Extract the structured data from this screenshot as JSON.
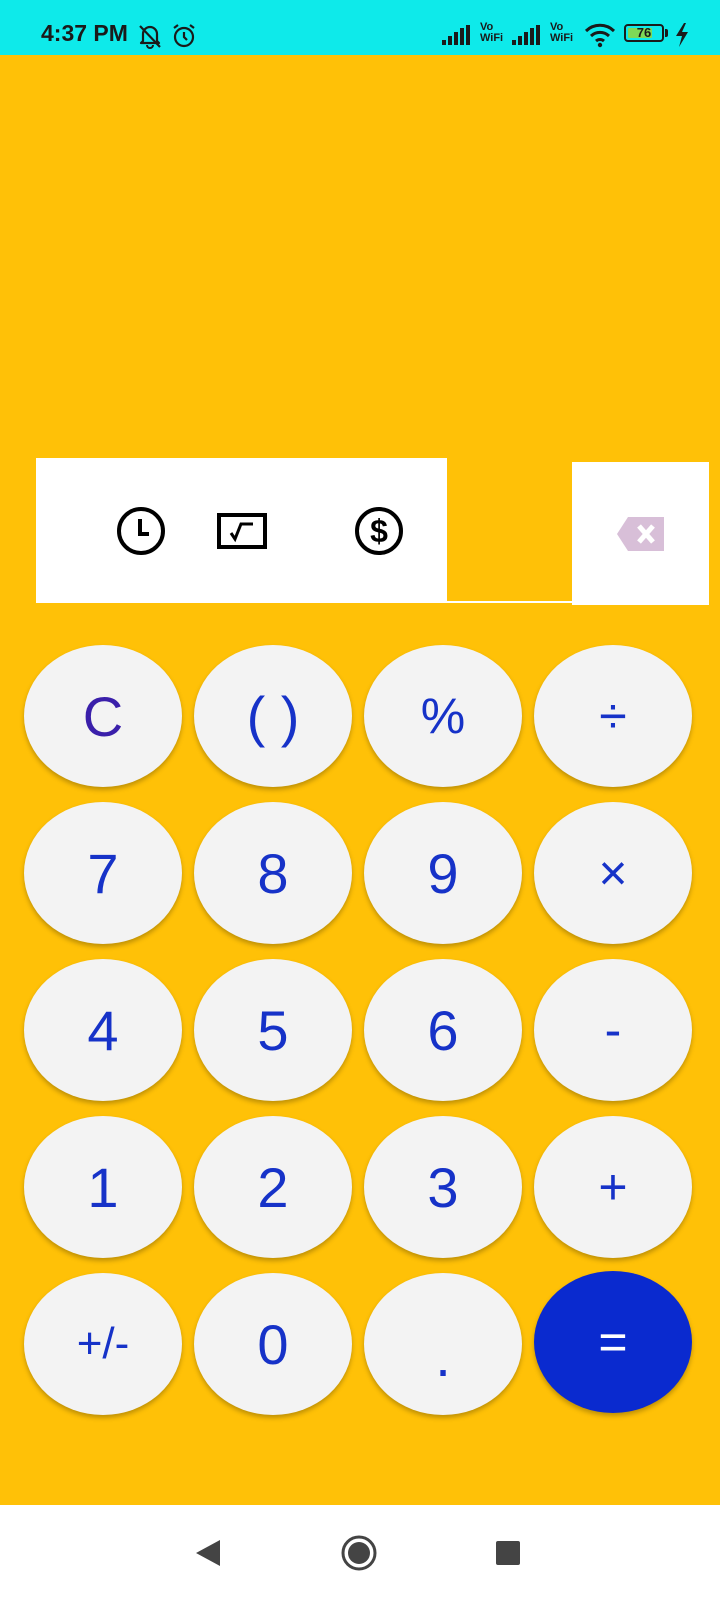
{
  "status_bar": {
    "time": "4:37 PM",
    "icons": [
      "bell-off-icon",
      "alarm-icon",
      "signal-icon",
      "vo-wifi-icon",
      "signal-icon",
      "vo-wifi-icon",
      "wifi-icon",
      "battery-icon",
      "charging-icon"
    ],
    "vo_label": "Vo",
    "wifi_label": "WiFi",
    "battery_level": "76",
    "battery_fraction": 0.76
  },
  "tools": {
    "items": [
      "history-clock-icon",
      "unit-converter-icon",
      "currency-dollar-icon"
    ],
    "backspace_icon": "backspace-icon"
  },
  "keypad": {
    "rows": [
      [
        "C",
        "( )",
        "%",
        "÷"
      ],
      [
        "7",
        "8",
        "9",
        "×"
      ],
      [
        "4",
        "5",
        "6",
        "-"
      ],
      [
        "1",
        "2",
        "3",
        "+"
      ],
      [
        "+/-",
        "0",
        ".",
        "="
      ]
    ]
  },
  "colors": {
    "background": "#FFC107",
    "status_bar": "#0EEAEA",
    "key_background": "#F3F3F3",
    "key_text": "#1632C8",
    "clear_text": "#3A1FAA",
    "equals_background": "#0A2ACF",
    "backspace_icon": "#D8BFD8"
  },
  "nav_bar": {
    "icons": [
      "back-triangle-icon",
      "home-circle-icon",
      "recents-square-icon"
    ]
  }
}
